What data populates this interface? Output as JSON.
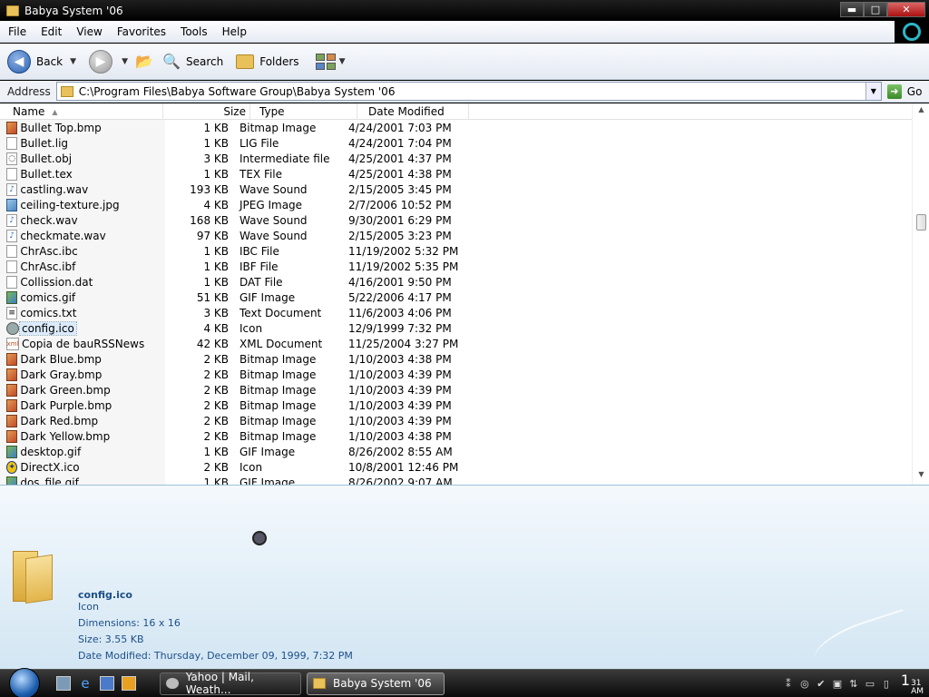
{
  "window": {
    "title": "Babya System '06",
    "controls": {
      "minimize": "▬",
      "maximize": "□",
      "close": "✕"
    }
  },
  "menu": [
    "File",
    "Edit",
    "View",
    "Favorites",
    "Tools",
    "Help"
  ],
  "toolbar": {
    "back_label": "Back",
    "search_label": "Search",
    "folders_label": "Folders"
  },
  "address": {
    "label": "Address",
    "path": "C:\\Program Files\\Babya Software Group\\Babya System '06",
    "go_label": "Go"
  },
  "columns": {
    "name": "Name",
    "size": "Size",
    "type": "Type",
    "date": "Date Modified"
  },
  "files": [
    {
      "name": "Bullet Top.bmp",
      "size": "1 KB",
      "type": "Bitmap Image",
      "date": "4/24/2001 7:03 PM",
      "icon": "bmp"
    },
    {
      "name": "Bullet.lig",
      "size": "1 KB",
      "type": "LIG File",
      "date": "4/24/2001 7:04 PM",
      "icon": "blank"
    },
    {
      "name": "Bullet.obj",
      "size": "3 KB",
      "type": "Intermediate file",
      "date": "4/25/2001 4:37 PM",
      "icon": "obj"
    },
    {
      "name": "Bullet.tex",
      "size": "1 KB",
      "type": "TEX File",
      "date": "4/25/2001 4:38 PM",
      "icon": "blank"
    },
    {
      "name": "castling.wav",
      "size": "193 KB",
      "type": "Wave Sound",
      "date": "2/15/2005 3:45 PM",
      "icon": "wav"
    },
    {
      "name": "ceiling-texture.jpg",
      "size": "4 KB",
      "type": "JPEG Image",
      "date": "2/7/2006 10:52 PM",
      "icon": "jpg"
    },
    {
      "name": "check.wav",
      "size": "168 KB",
      "type": "Wave Sound",
      "date": "9/30/2001 6:29 PM",
      "icon": "wav"
    },
    {
      "name": "checkmate.wav",
      "size": "97 KB",
      "type": "Wave Sound",
      "date": "2/15/2005 3:23 PM",
      "icon": "wav"
    },
    {
      "name": "ChrAsc.ibc",
      "size": "1 KB",
      "type": "IBC File",
      "date": "11/19/2002 5:32 PM",
      "icon": "blank"
    },
    {
      "name": "ChrAsc.ibf",
      "size": "1 KB",
      "type": "IBF File",
      "date": "11/19/2002 5:35 PM",
      "icon": "blank"
    },
    {
      "name": "Collission.dat",
      "size": "1 KB",
      "type": "DAT File",
      "date": "4/16/2001 9:50 PM",
      "icon": "blank"
    },
    {
      "name": "comics.gif",
      "size": "51 KB",
      "type": "GIF Image",
      "date": "5/22/2006 4:17 PM",
      "icon": "gif"
    },
    {
      "name": "comics.txt",
      "size": "3 KB",
      "type": "Text Document",
      "date": "11/6/2003 4:06 PM",
      "icon": "txt"
    },
    {
      "name": "config.ico",
      "size": "4 KB",
      "type": "Icon",
      "date": "12/9/1999 7:32 PM",
      "icon": "gear",
      "selected": true
    },
    {
      "name": "Copia de bauRSSNews.xml",
      "size": "42 KB",
      "type": "XML Document",
      "date": "11/25/2004 3:27 PM",
      "icon": "xml"
    },
    {
      "name": "Dark Blue.bmp",
      "size": "2 KB",
      "type": "Bitmap Image",
      "date": "1/10/2003 4:38 PM",
      "icon": "bmp"
    },
    {
      "name": "Dark Gray.bmp",
      "size": "2 KB",
      "type": "Bitmap Image",
      "date": "1/10/2003 4:39 PM",
      "icon": "bmp"
    },
    {
      "name": "Dark Green.bmp",
      "size": "2 KB",
      "type": "Bitmap Image",
      "date": "1/10/2003 4:39 PM",
      "icon": "bmp"
    },
    {
      "name": "Dark Purple.bmp",
      "size": "2 KB",
      "type": "Bitmap Image",
      "date": "1/10/2003 4:39 PM",
      "icon": "bmp"
    },
    {
      "name": "Dark Red.bmp",
      "size": "2 KB",
      "type": "Bitmap Image",
      "date": "1/10/2003 4:39 PM",
      "icon": "bmp"
    },
    {
      "name": "Dark Yellow.bmp",
      "size": "2 KB",
      "type": "Bitmap Image",
      "date": "1/10/2003 4:38 PM",
      "icon": "bmp"
    },
    {
      "name": "desktop.gif",
      "size": "1 KB",
      "type": "GIF Image",
      "date": "8/26/2002 8:55 AM",
      "icon": "gif"
    },
    {
      "name": "DirectX.ico",
      "size": "2 KB",
      "type": "Icon",
      "date": "10/8/2001 12:46 PM",
      "icon": "star"
    },
    {
      "name": "dos_file.gif",
      "size": "1 KB",
      "type": "GIF Image",
      "date": "8/26/2002 9:07 AM",
      "icon": "gif"
    }
  ],
  "details": {
    "name": "config.ico",
    "type": "Icon",
    "dimensions": "Dimensions: 16 x 16",
    "size": "Size: 3.55 KB",
    "date_modified": "Date Modified: Thursday, December 09, 1999, 7:32 PM"
  },
  "taskbar": {
    "tasks": [
      "Yahoo | Mail, Weath...",
      "Babya System '06"
    ],
    "clock_hour": "1",
    "clock_min": "31",
    "clock_ampm": "AM"
  }
}
